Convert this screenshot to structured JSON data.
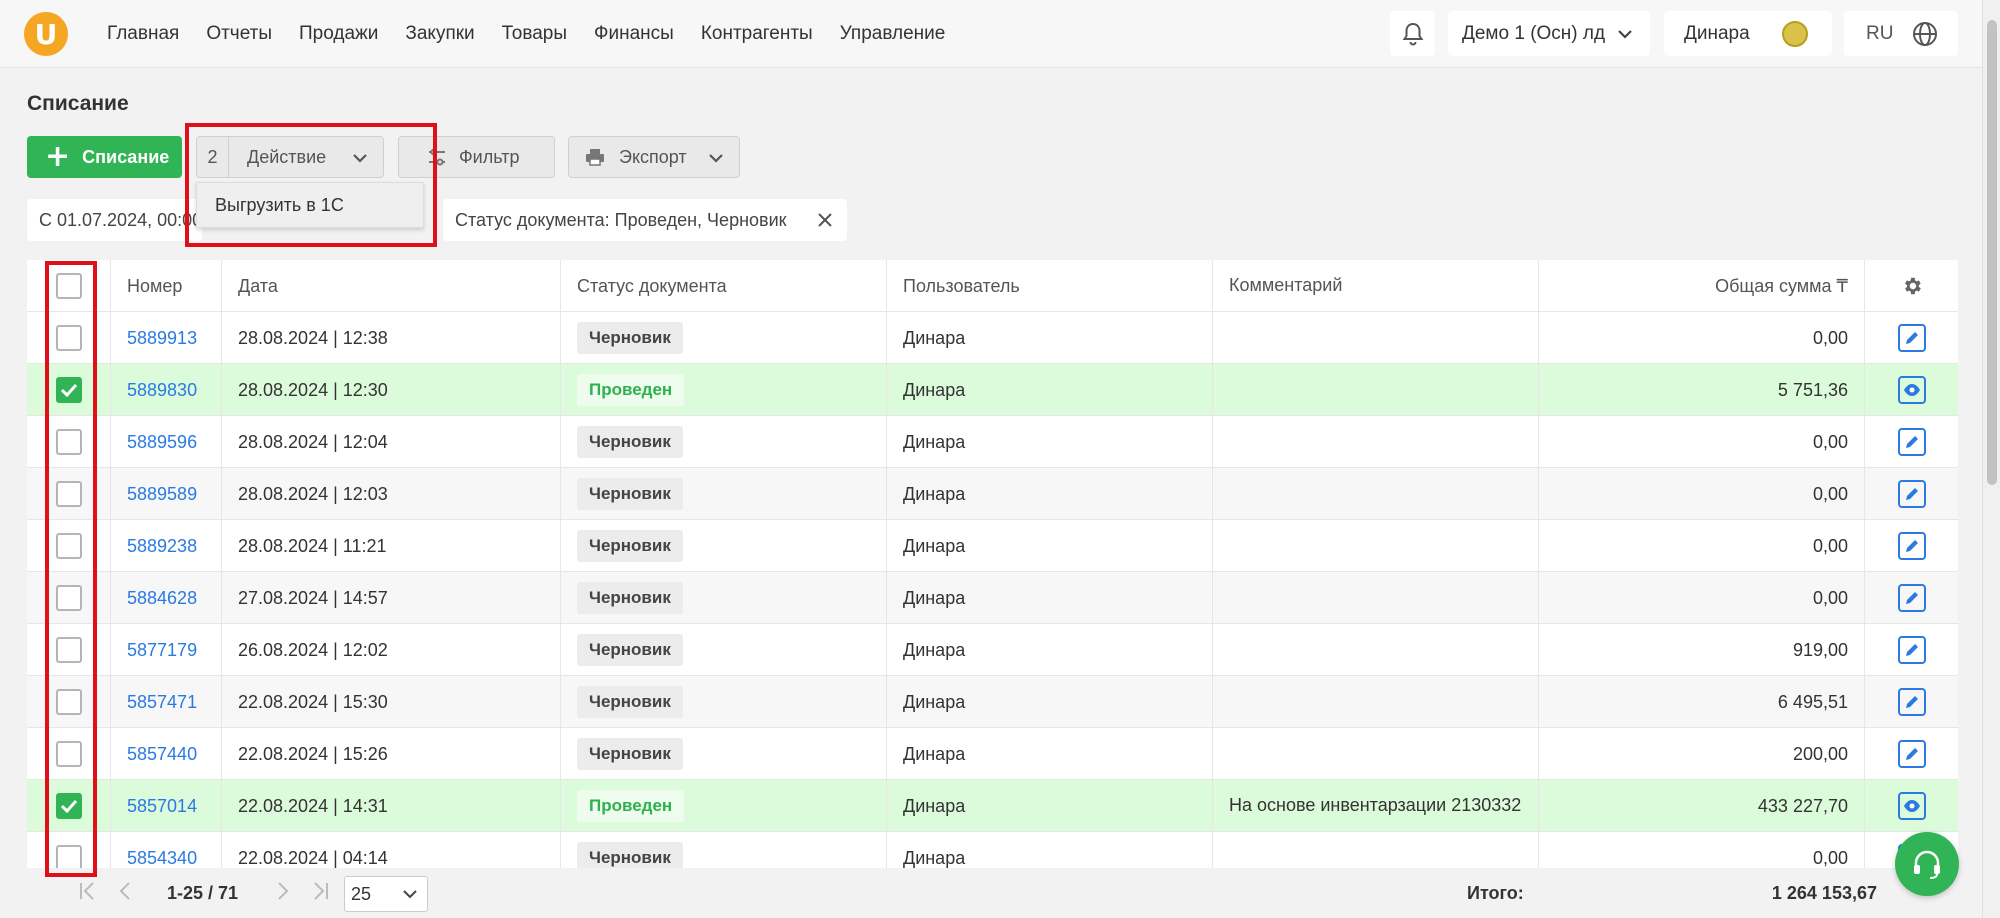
{
  "nav": {
    "items": [
      "Главная",
      "Отчеты",
      "Продажи",
      "Закупки",
      "Товары",
      "Финансы",
      "Контрагенты",
      "Управление"
    ],
    "company": "Демо 1 (Осн) лд",
    "user": "Динара",
    "lang": "RU",
    "logo_letter": "U"
  },
  "page": {
    "title": "Списание"
  },
  "toolbar": {
    "add_label": "Списание",
    "selected_count": "2",
    "action_label": "Действие",
    "filter_label": "Фильтр",
    "export_label": "Экспорт"
  },
  "dropdown": {
    "item": "Выгрузить в 1С"
  },
  "filters": {
    "date_chip": "С 01.07.2024, 00:00",
    "status_chip": "Статус документа: Проведен, Черновик"
  },
  "table": {
    "headers": [
      "Номер",
      "Дата",
      "Статус документа",
      "Пользователь",
      "Комментарий",
      "Общая сумма ₸"
    ],
    "rows": [
      {
        "number": "5889913",
        "date": "28.08.2024 | 12:38",
        "status": "Черновик",
        "user": "Динара",
        "comment": "",
        "sum": "0,00"
      },
      {
        "number": "5889830",
        "date": "28.08.2024 | 12:30",
        "status": "Проведен",
        "user": "Динара",
        "comment": "",
        "sum": "5 751,36"
      },
      {
        "number": "5889596",
        "date": "28.08.2024 | 12:04",
        "status": "Черновик",
        "user": "Динара",
        "comment": "",
        "sum": "0,00"
      },
      {
        "number": "5889589",
        "date": "28.08.2024 | 12:03",
        "status": "Черновик",
        "user": "Динара",
        "comment": "",
        "sum": "0,00"
      },
      {
        "number": "5889238",
        "date": "28.08.2024 | 11:21",
        "status": "Черновик",
        "user": "Динара",
        "comment": "",
        "sum": "0,00"
      },
      {
        "number": "5884628",
        "date": "27.08.2024 | 14:57",
        "status": "Черновик",
        "user": "Динара",
        "comment": "",
        "sum": "0,00"
      },
      {
        "number": "5877179",
        "date": "26.08.2024 | 12:02",
        "status": "Черновик",
        "user": "Динара",
        "comment": "",
        "sum": "919,00"
      },
      {
        "number": "5857471",
        "date": "22.08.2024 | 15:30",
        "status": "Черновик",
        "user": "Динара",
        "comment": "",
        "sum": "6 495,51"
      },
      {
        "number": "5857440",
        "date": "22.08.2024 | 15:26",
        "status": "Черновик",
        "user": "Динара",
        "comment": "",
        "sum": "200,00"
      },
      {
        "number": "5857014",
        "date": "22.08.2024 | 14:31",
        "status": "Проведен",
        "user": "Динара",
        "comment": "На основе инвентарзации 2130332",
        "sum": "433 227,70"
      },
      {
        "number": "5854340",
        "date": "22.08.2024 | 04:14",
        "status": "Черновик",
        "user": "Динара",
        "comment": "",
        "sum": "0,00"
      }
    ]
  },
  "pagination": {
    "range": "1-25 / 71",
    "page_size": "25"
  },
  "totals": {
    "label": "Итого:",
    "value": "1 264 153,67"
  },
  "colors": {
    "accent": "#31b455",
    "link": "#2a7ae2",
    "highlight": "#e0101a",
    "selected_row": "#dbfbdb"
  }
}
